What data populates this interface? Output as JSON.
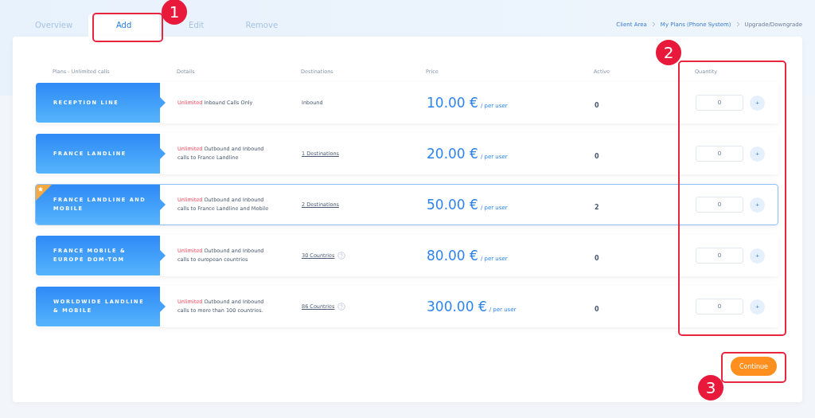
{
  "tabs": [
    {
      "label": "Overview",
      "selected": false
    },
    {
      "label": "Add",
      "selected": true
    },
    {
      "label": "Edit",
      "selected": false
    },
    {
      "label": "Remove",
      "selected": false
    }
  ],
  "breadcrumb": [
    "Client Area",
    "My Plans (Phone System)",
    "Upgrade/Downgrade"
  ],
  "columns": [
    "Plans - Unlimited calls",
    "Details",
    "Destinations",
    "Price",
    "Active",
    "Quantity"
  ],
  "plans": [
    {
      "name": "RECEPTION LINE",
      "featured": false,
      "selected": false,
      "highlight": "Unlimited",
      "details": "Inbound Calls Only",
      "destinations": "Inbound",
      "link": false,
      "info": false,
      "price": "10.00 €",
      "unit": "/ per user",
      "active": "0",
      "quantity": "0"
    },
    {
      "name": "FRANCE LANDLINE",
      "featured": false,
      "selected": false,
      "highlight": "Unlimited",
      "details": "Outbound and Inbound calls to France Landline",
      "destinations": "1 Destinations",
      "link": true,
      "info": false,
      "price": "20.00 €",
      "unit": "/ per user",
      "active": "0",
      "quantity": "0"
    },
    {
      "name": "FRANCE LANDLINE AND MOBILE",
      "featured": true,
      "selected": true,
      "highlight": "Unlimited",
      "details": "Outbound and Inbound calls to France Landline and Mobile",
      "destinations": "2 Destinations",
      "link": true,
      "info": false,
      "price": "50.00 €",
      "unit": "/ per user",
      "active": "2",
      "quantity": "0"
    },
    {
      "name": "FRANCE MOBILE & EUROPE DOM-TOM",
      "featured": false,
      "selected": false,
      "highlight": "Unlimited",
      "details": "Outbound and Inbound calls to european countries",
      "destinations": "30 Countries",
      "link": true,
      "info": true,
      "price": "80.00 €",
      "unit": "/ per user",
      "active": "0",
      "quantity": "0"
    },
    {
      "name": "WORLDWIDE LANDLINE & MOBILE",
      "featured": false,
      "selected": false,
      "highlight": "Unlimited",
      "details": "Outbound and Inbound calls to more than 100 countries.",
      "destinations": "86 Countries",
      "link": true,
      "info": true,
      "price": "300.00 €",
      "unit": "/ per user",
      "active": "0",
      "quantity": "0"
    }
  ],
  "add_symbol": "+",
  "continue_button": "Continue",
  "callouts": [
    "1",
    "2",
    "3"
  ]
}
